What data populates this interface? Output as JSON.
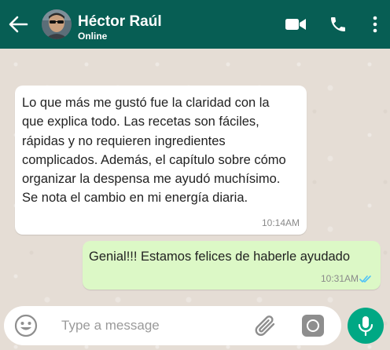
{
  "header": {
    "contact_name": "Héctor Raúl",
    "status": "Online",
    "background_color": "#075e54"
  },
  "icons": {
    "back": "arrow-left-icon",
    "video": "video-camera-icon",
    "call": "phone-icon",
    "menu": "more-vertical-icon",
    "emoji": "emoji-icon",
    "attach": "paperclip-icon",
    "camera": "camera-icon",
    "mic": "microphone-icon",
    "read_receipt": "double-check-icon"
  },
  "messages": [
    {
      "direction": "incoming",
      "text": "Lo que más me gustó fue la claridad con la que explica todo. Las recetas son fáciles, rápidas y no requieren ingredientes complicados. Además, el capítulo sobre cómo organizar la despensa me ayudó muchísimo. Se nota el cambio en mi energía diaria.",
      "time": "10:14AM"
    },
    {
      "direction": "outgoing",
      "text": "Genial!!! Estamos felices de haberle ayudado",
      "time": "10:31AM",
      "read": true
    }
  ],
  "composer": {
    "placeholder": "Type a message",
    "value": ""
  },
  "colors": {
    "incoming_bubble": "#ffffff",
    "outgoing_bubble": "#dcf8c6",
    "chat_background": "#e5ddd5",
    "mic_button": "#00a884",
    "read_tick": "#4fc3f7"
  }
}
